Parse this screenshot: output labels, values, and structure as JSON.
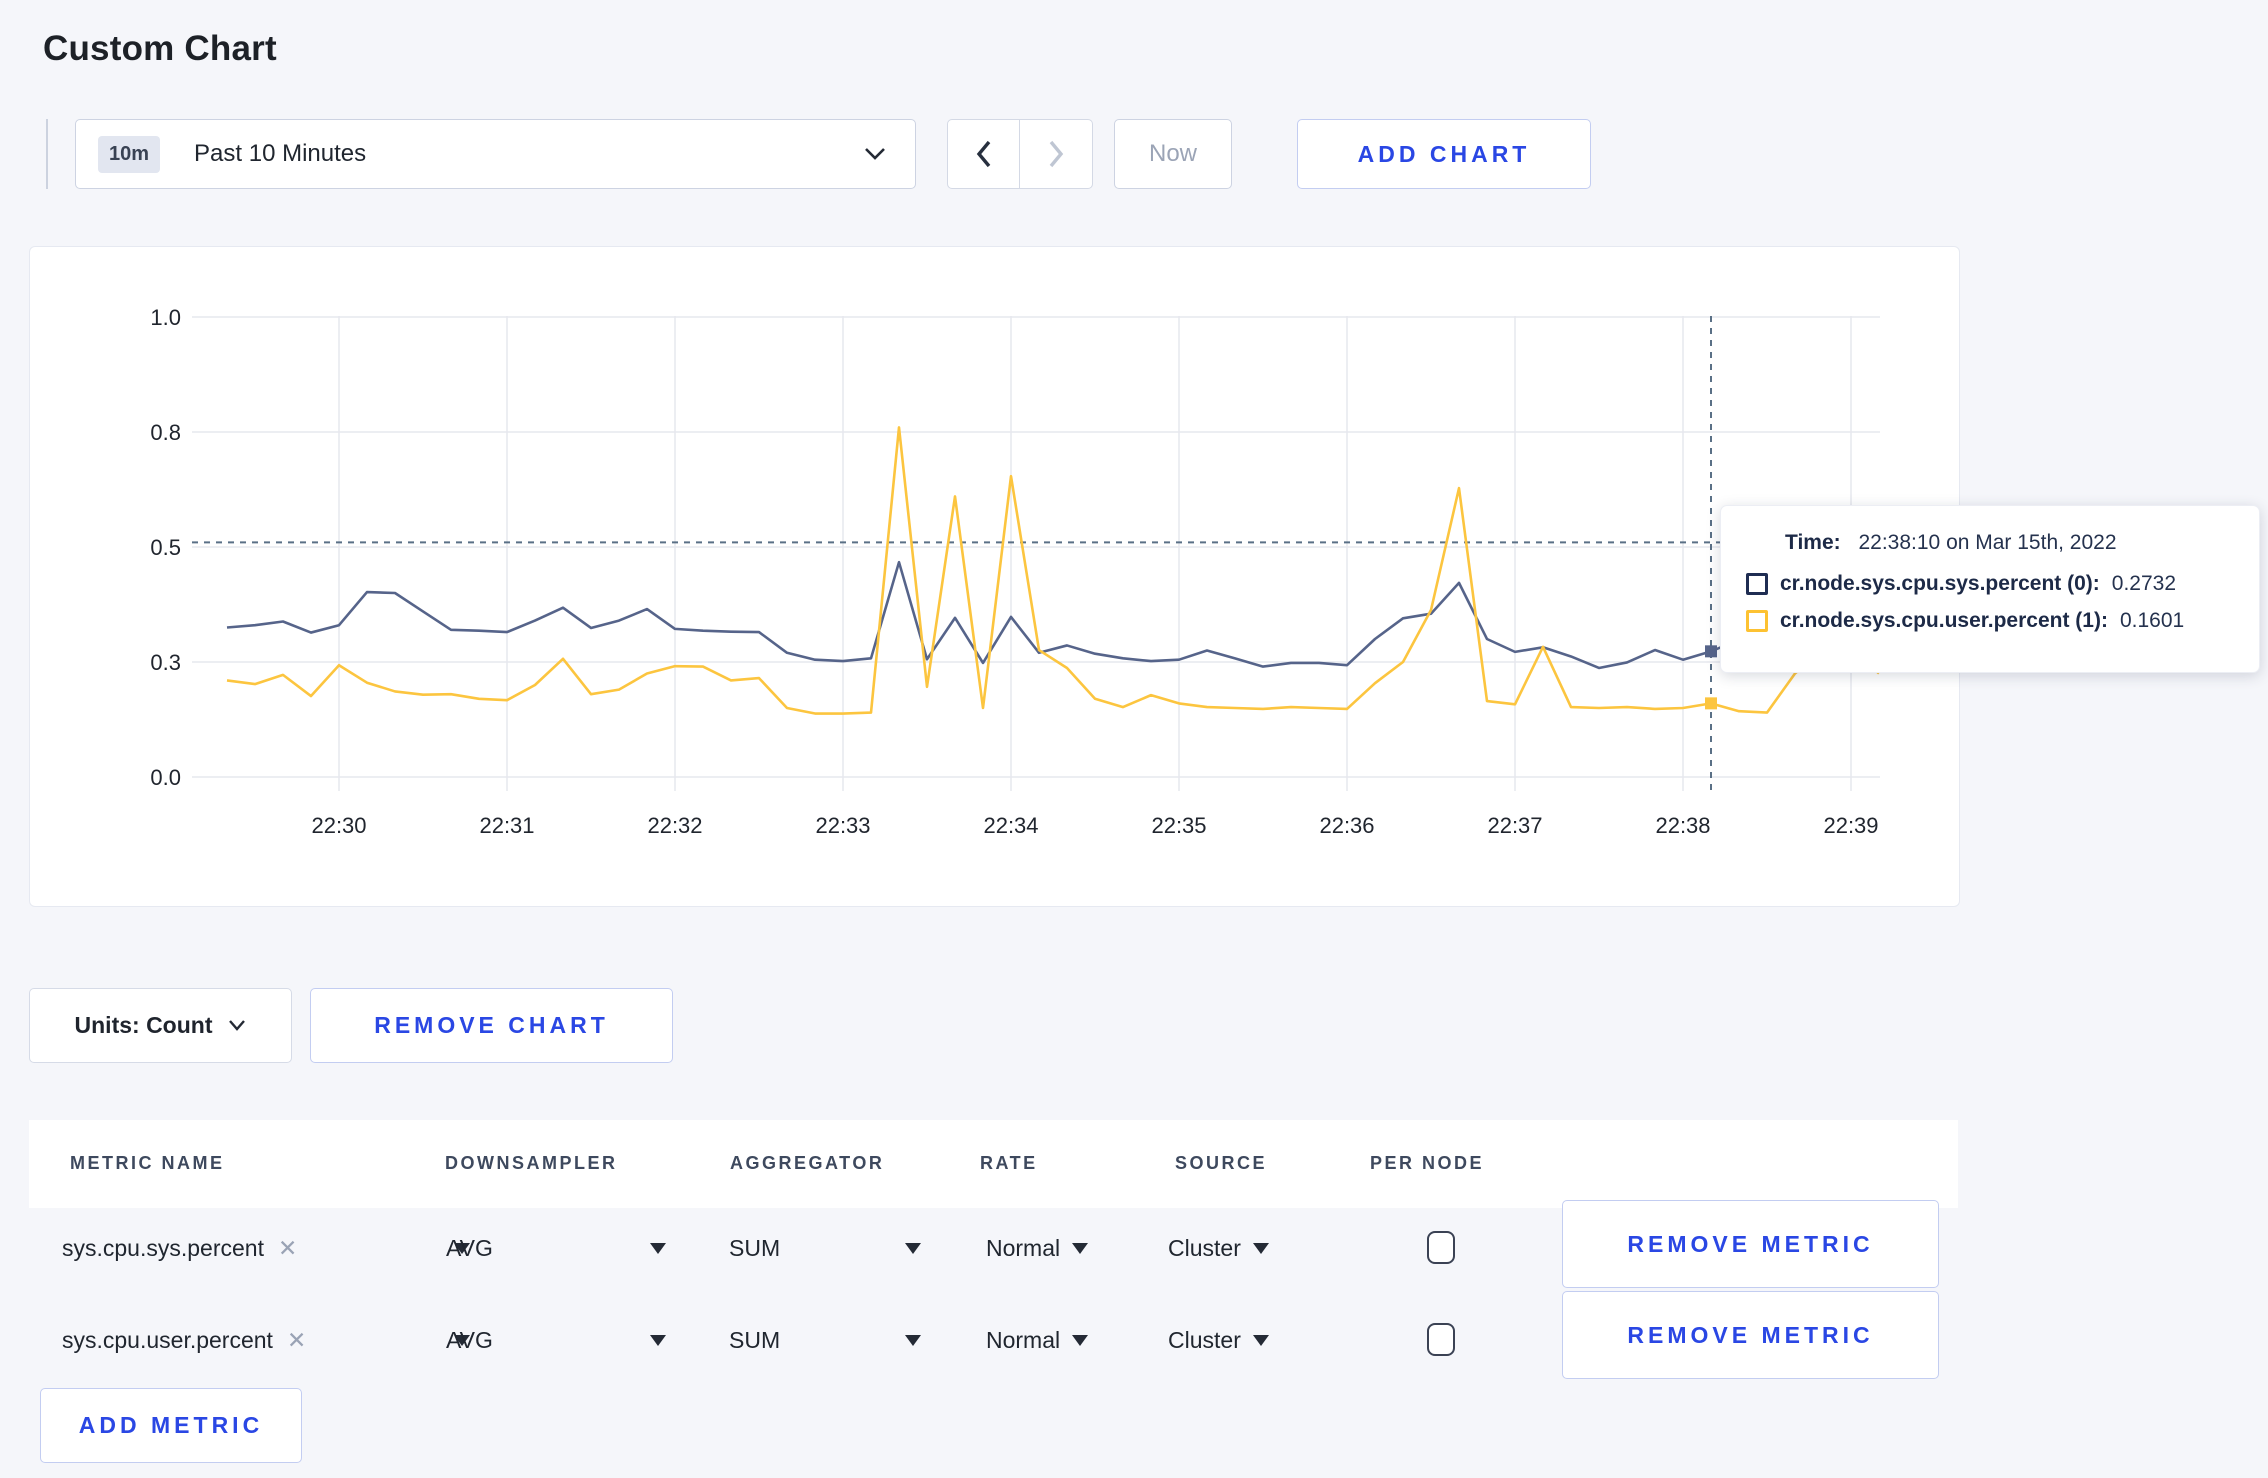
{
  "page": {
    "title": "Custom Chart"
  },
  "toolbar": {
    "range_badge": "10m",
    "range_label": "Past 10 Minutes",
    "now_label": "Now",
    "add_chart_label": "ADD CHART"
  },
  "chart_controls": {
    "units_label": "Units: Count",
    "remove_chart_label": "REMOVE CHART"
  },
  "chart_data": {
    "type": "line",
    "title": "",
    "xlabel": "",
    "ylabel": "",
    "ylim": [
      0,
      1
    ],
    "grid": true,
    "legend_position": "none",
    "x_start_label": "22:29:20",
    "x_step_seconds": 10,
    "x_ticks": [
      "22:30",
      "22:31",
      "22:32",
      "22:33",
      "22:34",
      "22:35",
      "22:36",
      "22:37",
      "22:38",
      "22:39"
    ],
    "y_ticks": [
      {
        "v": 0,
        "label": "0.0"
      },
      {
        "v": 0.25,
        "label": "0.3"
      },
      {
        "v": 0.5,
        "label": "0.5"
      },
      {
        "v": 0.75,
        "label": "0.8"
      },
      {
        "v": 1,
        "label": "1.0"
      }
    ],
    "series": [
      {
        "name": "cr.node.sys.cpu.sys.percent (0)",
        "color": "#56648a",
        "values": [
          0.325,
          0.33,
          0.338,
          0.314,
          0.33,
          0.402,
          0.4,
          0.36,
          0.32,
          0.318,
          0.315,
          0.34,
          0.368,
          0.324,
          0.34,
          0.365,
          0.322,
          0.318,
          0.316,
          0.315,
          0.27,
          0.255,
          0.252,
          0.258,
          0.467,
          0.256,
          0.346,
          0.248,
          0.348,
          0.27,
          0.286,
          0.268,
          0.258,
          0.252,
          0.255,
          0.275,
          0.258,
          0.24,
          0.248,
          0.248,
          0.243,
          0.3,
          0.345,
          0.355,
          0.422,
          0.3,
          0.272,
          0.282,
          0.262,
          0.237,
          0.249,
          0.276,
          0.255,
          0.2732,
          0.298,
          0.3,
          0.302,
          0.3,
          0.298,
          0.295
        ]
      },
      {
        "name": "cr.node.sys.cpu.user.percent (1)",
        "color": "#fcc53f",
        "values": [
          0.21,
          0.202,
          0.222,
          0.176,
          0.243,
          0.205,
          0.186,
          0.179,
          0.18,
          0.17,
          0.167,
          0.2,
          0.257,
          0.18,
          0.19,
          0.225,
          0.241,
          0.24,
          0.21,
          0.215,
          0.15,
          0.138,
          0.138,
          0.14,
          0.76,
          0.196,
          0.61,
          0.15,
          0.654,
          0.276,
          0.237,
          0.17,
          0.152,
          0.178,
          0.16,
          0.152,
          0.15,
          0.148,
          0.152,
          0.15,
          0.148,
          0.204,
          0.25,
          0.363,
          0.628,
          0.165,
          0.158,
          0.283,
          0.152,
          0.15,
          0.152,
          0.148,
          0.15,
          0.1601,
          0.143,
          0.14,
          0.225,
          0.275,
          0.278,
          0.225
        ]
      }
    ],
    "hover": {
      "index": 53,
      "time": "22:38:10 on Mar 15th, 2022",
      "line_value": 0.51,
      "values": [
        0.2732,
        0.1601
      ]
    }
  },
  "tooltip": {
    "time_label": "Time:",
    "time_value": "22:38:10 on Mar 15th, 2022",
    "rows": [
      {
        "label": "cr.node.sys.cpu.sys.percent (0):",
        "value": "0.2732",
        "swatch_color": "#1f2d52"
      },
      {
        "label": "cr.node.sys.cpu.user.percent (1):",
        "value": "0.1601",
        "swatch_color": "#fdc232"
      }
    ]
  },
  "metrics_table": {
    "headers": [
      "METRIC NAME",
      "DOWNSAMPLER",
      "AGGREGATOR",
      "RATE",
      "SOURCE",
      "PER NODE"
    ],
    "rows": [
      {
        "metric": "sys.cpu.sys.percent",
        "clear": "✕",
        "downsampler": "AVG",
        "aggregator": "SUM",
        "rate": "Normal",
        "source": "Cluster",
        "per_node_checked": false,
        "remove_label": "REMOVE METRIC"
      },
      {
        "metric": "sys.cpu.user.percent",
        "clear": "✕",
        "downsampler": "AVG",
        "aggregator": "SUM",
        "rate": "Normal",
        "source": "Cluster",
        "per_node_checked": false,
        "remove_label": "REMOVE METRIC"
      }
    ],
    "add_metric_label": "ADD METRIC"
  }
}
